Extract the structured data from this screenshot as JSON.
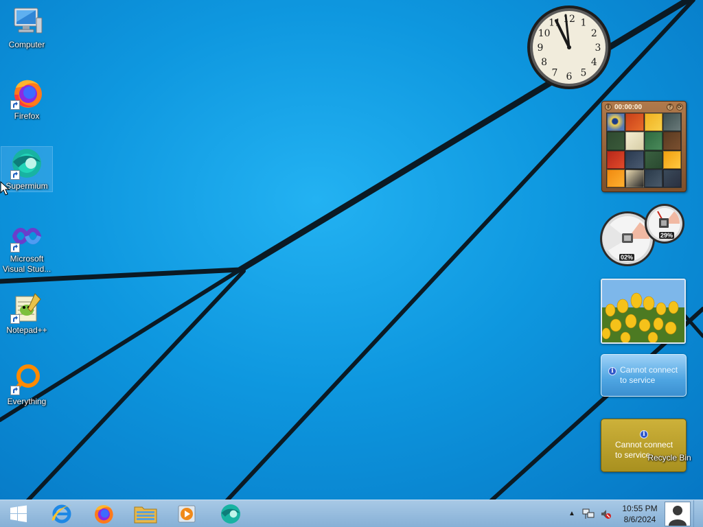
{
  "desktop": {
    "icons": [
      {
        "label": "Computer",
        "icon": "computer-icon"
      },
      {
        "label": "Firefox",
        "icon": "firefox-icon"
      },
      {
        "label": "Supermium",
        "icon": "supermium-icon"
      },
      {
        "label": "Microsoft Visual Stud...",
        "icon": "visual-studio-icon"
      },
      {
        "label": "Notepad++",
        "icon": "notepadpp-icon"
      },
      {
        "label": "Everything",
        "icon": "everything-icon"
      }
    ],
    "recycle_bin": {
      "label": "Recycle Bin",
      "icon": "recycle-bin-icon"
    }
  },
  "gadgets": {
    "clock": {
      "numerals": [
        "12",
        "1",
        "2",
        "3",
        "4",
        "5",
        "6",
        "7",
        "8",
        "9",
        "10",
        "11"
      ]
    },
    "puzzle": {
      "timer": "00:00:00",
      "help_label": "?"
    },
    "cpu_meter": {
      "cpu_value": "02%",
      "memory_value": "29%"
    },
    "weather": {
      "message": "Cannot connect to service"
    },
    "currency": {
      "message": "Cannot connect to service"
    }
  },
  "taskbar": {
    "pinned": [
      {
        "name": "internet-explorer",
        "icon": "internet-explorer-icon"
      },
      {
        "name": "firefox",
        "icon": "firefox-icon"
      },
      {
        "name": "file-explorer",
        "icon": "folder-icon"
      },
      {
        "name": "media-player",
        "icon": "media-player-icon"
      },
      {
        "name": "supermium",
        "icon": "supermium-icon"
      }
    ],
    "time": "10:55 PM",
    "date": "8/6/2024"
  },
  "colors": {
    "wallpaper": "#0e97df",
    "taskbar": "#a8c9e6",
    "stripe": "#0b1a24"
  }
}
